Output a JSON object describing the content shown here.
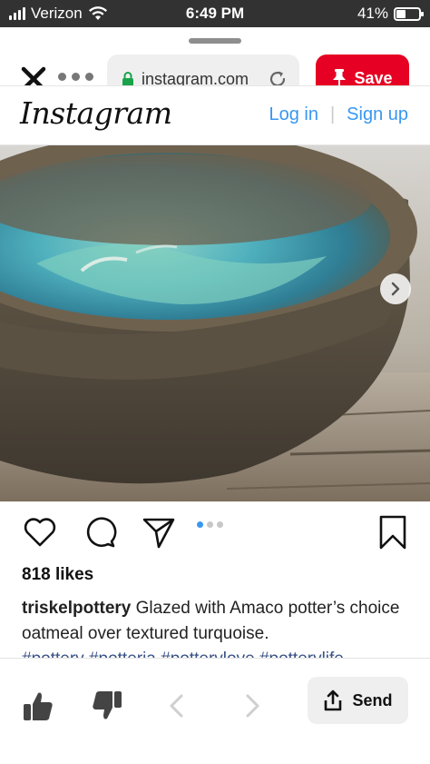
{
  "status": {
    "carrier": "Verizon",
    "time": "6:49 PM",
    "battery_text": "41%",
    "battery_level": 0.41
  },
  "browser": {
    "url": "instagram.com",
    "save_label": "Save",
    "accent": "#e60023"
  },
  "instagram": {
    "logo": "Instagram",
    "login": "Log in",
    "signup": "Sign up",
    "link_color": "#3897f0"
  },
  "post": {
    "likes": "818 likes",
    "username": "triskelpottery",
    "caption": "Glazed with Amaco potter’s choice oatmeal over textured turquoise.",
    "hashtags": "#pottery #potteria #potterylove #potterylife",
    "carousel_count": 3,
    "carousel_active": 0
  },
  "toolbar": {
    "send_label": "Send"
  },
  "icons": [
    "wifi-icon",
    "close-icon",
    "more-icon",
    "lock-icon",
    "reload-icon",
    "pin-icon",
    "heart-icon",
    "comment-icon",
    "share-icon",
    "bookmark-icon",
    "thumbs-up-icon",
    "thumbs-down-icon",
    "back-icon",
    "forward-icon",
    "upload-icon",
    "chevron-right-icon"
  ]
}
